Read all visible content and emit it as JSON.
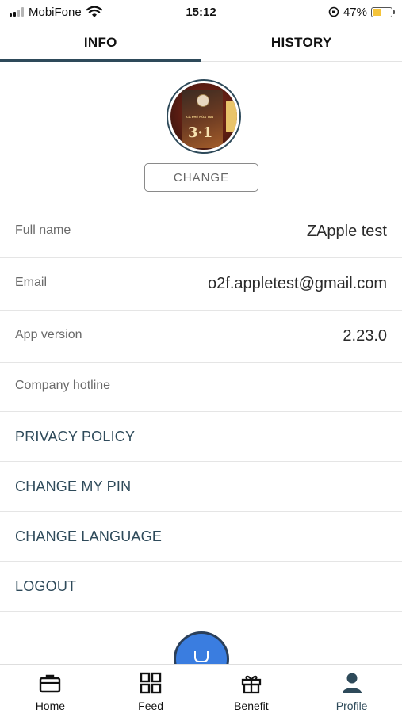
{
  "status_bar": {
    "carrier": "MobiFone",
    "time": "15:12",
    "battery_percent": "47%",
    "battery_level": 0.47,
    "icons": [
      "signal-icon",
      "wifi-icon",
      "orientation-lock-icon",
      "battery-icon"
    ]
  },
  "tabs": [
    {
      "label": "INFO",
      "active": true
    },
    {
      "label": "HISTORY",
      "active": false
    }
  ],
  "avatar": {
    "pack_label": "CÀ PHÊ HÒA TAN",
    "pack_number": "3in1"
  },
  "change_button_label": "CHANGE",
  "info_rows": [
    {
      "label": "Full name",
      "value": "ZApple test"
    },
    {
      "label": "Email",
      "value": "o2f.appletest@gmail.com"
    },
    {
      "label": "App version",
      "value": "2.23.0"
    },
    {
      "label": "Company hotline",
      "value": ""
    }
  ],
  "actions": [
    {
      "label": "PRIVACY POLICY"
    },
    {
      "label": "CHANGE MY PIN"
    },
    {
      "label": "CHANGE LANGUAGE"
    },
    {
      "label": "LOGOUT"
    }
  ],
  "bottom_nav": [
    {
      "label": "Home",
      "icon": "briefcase-icon",
      "active": false
    },
    {
      "label": "Feed",
      "icon": "grid-icon",
      "active": false
    },
    {
      "label": "Benefit",
      "icon": "gift-icon",
      "active": false
    },
    {
      "label": "Profile",
      "icon": "person-icon",
      "active": true
    }
  ],
  "colors": {
    "accent": "#2e4a5a",
    "fab": "#3a7de0",
    "battery": "#f5c43a"
  }
}
